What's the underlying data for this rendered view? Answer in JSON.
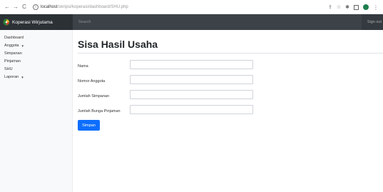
{
  "browser": {
    "nav_back": "←",
    "nav_forward": "→",
    "nav_reload": "C",
    "url_host": "localhost",
    "url_path": "/skripsi/koperasi/dashboard/SHU.php"
  },
  "navbar": {
    "brand": "Koperasi Wirjutama",
    "search_placeholder": "Search",
    "signout": "Sign out"
  },
  "sidebar": {
    "items": [
      {
        "label": "Dashboard",
        "caret": ""
      },
      {
        "label": "Anggota",
        "caret": "▼"
      },
      {
        "label": "Simpanan",
        "caret": ""
      },
      {
        "label": "Pinjaman",
        "caret": ""
      },
      {
        "label": "SHU",
        "caret": ""
      },
      {
        "label": "Laporan",
        "caret": "▼"
      }
    ]
  },
  "main": {
    "title": "Sisa Hasil Usaha",
    "fields": [
      {
        "label": "Nama",
        "value": ""
      },
      {
        "label": "Nomor Anggota",
        "value": ""
      },
      {
        "label": "Jumlah Simpanan",
        "value": ""
      },
      {
        "label": "Jumlah Bunga Pinjaman",
        "value": ""
      }
    ],
    "submit_label": "Simpan"
  },
  "colors": {
    "navbar_bg": "#343a40",
    "brand_bg": "#2c3136",
    "primary": "#0d6efd",
    "sidebar_bg": "#f8f9fa"
  },
  "icons": [
    "back-arrow-icon",
    "forward-arrow-icon",
    "reload-icon",
    "site-info-icon",
    "share-icon",
    "star-icon",
    "extensions-icon",
    "sidebar-icon",
    "profile-icon",
    "menu-icon",
    "logo-icon"
  ]
}
